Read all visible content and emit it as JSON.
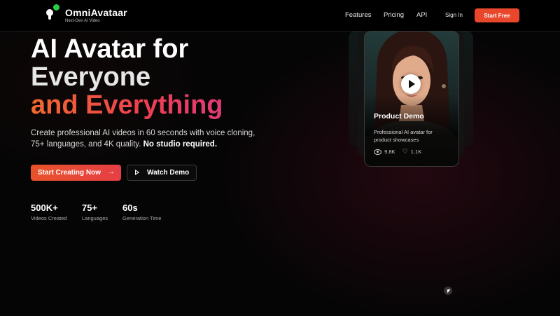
{
  "nav": {
    "brand_name": "OmniAvataar",
    "brand_tagline": "Next-Gen AI Video",
    "links": [
      "Features",
      "Pricing",
      "API"
    ],
    "signin_label": "Sign In",
    "cta_label": "Start Free"
  },
  "hero": {
    "line1": "AI Avatar for",
    "line2": "Everyone",
    "line3": "and Everything",
    "description": "Create professional AI videos in 60 seconds with voice cloning, 75+ languages, and 4K quality.",
    "description_bold": "No studio required.",
    "primary_cta": "Start Creating Now",
    "primary_cta_arrow": "→",
    "secondary_cta": "Watch Demo"
  },
  "stats": [
    {
      "value": "500K+",
      "label": "Videos Created"
    },
    {
      "value": "75+",
      "label": "Languages"
    },
    {
      "value": "60s",
      "label": "Generation Time"
    }
  ],
  "card": {
    "title": "Product Demo",
    "description": "Professional AI avatar for product showcases",
    "views": "9.8K",
    "likes": "1.1K"
  },
  "colors": {
    "accent": "#e8472c",
    "gradient_start": "#f26a2e",
    "gradient_end": "#e23a78",
    "logo_dot": "#2ecc40"
  },
  "icons": [
    "bulb-logo-icon",
    "arrow-right-icon",
    "play-icon",
    "eye-icon",
    "heart-icon",
    "cursor-icon"
  ]
}
